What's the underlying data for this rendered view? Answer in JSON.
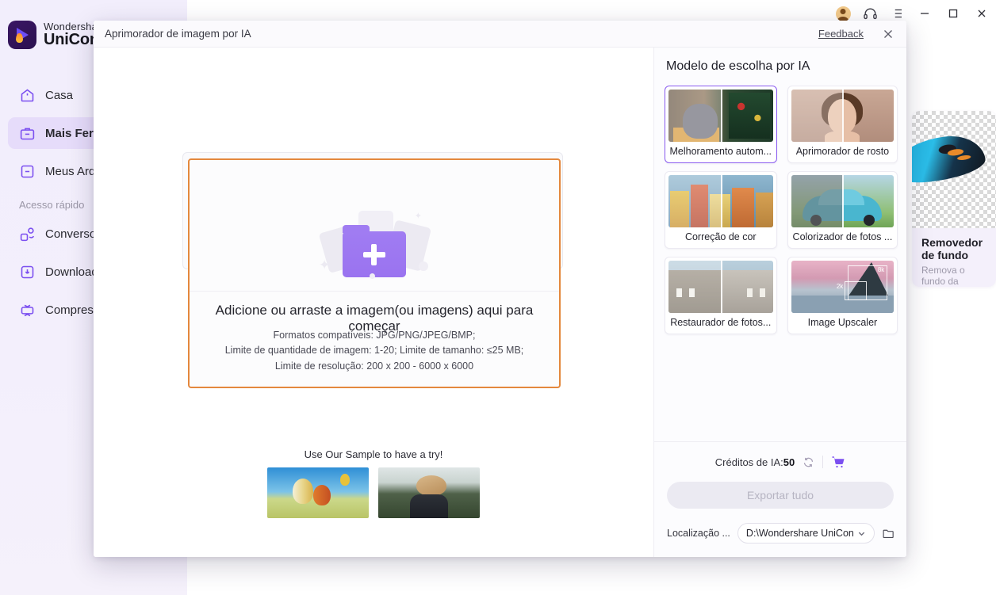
{
  "app": {
    "brand_line1": "Wondershare",
    "brand_line2": "UniConverter",
    "sidebar": {
      "items": [
        {
          "label": "Casa",
          "icon": "home-icon"
        },
        {
          "label": "Mais Ferramentas",
          "icon": "toolbox-icon"
        },
        {
          "label": "Meus Arquivos",
          "icon": "files-icon"
        }
      ],
      "quick_access_label": "Acesso rápido",
      "quick_items": [
        {
          "label": "Conversor",
          "icon": "convert-icon"
        },
        {
          "label": "Download",
          "icon": "download-icon"
        },
        {
          "label": "Compressor",
          "icon": "compress-icon"
        }
      ]
    },
    "background_card": {
      "title": "Removedor de fundo",
      "subtitle": "Remova o fundo da imagem"
    },
    "window_controls": {
      "account": "account-icon",
      "support": "headset-icon",
      "menu": "list-icon",
      "minimize": "minimize-icon",
      "maximize": "maximize-icon",
      "close": "close-icon"
    }
  },
  "modal": {
    "title": "Aprimorador de imagem por IA",
    "feedback_label": "Feedback",
    "close_icon": "close-icon",
    "dropzone": {
      "headline": "Adicione ou arraste a imagem(ou imagens) aqui para começar",
      "line1": "Formatos compatíveis: JPG/PNG/JPEG/BMP;",
      "line2": "Limite de quantidade de imagem: 1-20; Limite de tamanho: ≤25 MB;",
      "line3": "Limite de resolução: 200 x 200 - 6000 x 6000",
      "border_color": "#e4883d"
    },
    "samples": {
      "title": "Use Our Sample to have a try!",
      "items": [
        {
          "name": "hot-air-balloons-sample"
        },
        {
          "name": "woman-with-hat-sample"
        }
      ]
    },
    "panel": {
      "title": "Modelo de escolha por IA",
      "selected_index": 0,
      "accent_color": "#8a5cf0",
      "models": [
        {
          "label": "Melhoramento autom...",
          "art": "th-cat"
        },
        {
          "label": "Aprimorador de rosto",
          "art": "th-face"
        },
        {
          "label": "Correção de cor",
          "art": "th-town"
        },
        {
          "label": "Colorizador de fotos ...",
          "art": "th-car"
        },
        {
          "label": "Restaurador de fotos...",
          "art": "th-house"
        },
        {
          "label": "Image Upscaler",
          "art": "th-upscale",
          "badges": [
            "2k",
            "8k"
          ]
        }
      ],
      "footer": {
        "credits_label": "Créditos de IA:",
        "credits_value": "50",
        "refresh_icon": "refresh-icon",
        "cart_icon": "cart-icon",
        "export_label": "Exportar tudo",
        "export_enabled": false,
        "location_label": "Localização ...",
        "location_value": "D:\\Wondershare UniCon",
        "folder_icon": "folder-icon"
      }
    }
  }
}
